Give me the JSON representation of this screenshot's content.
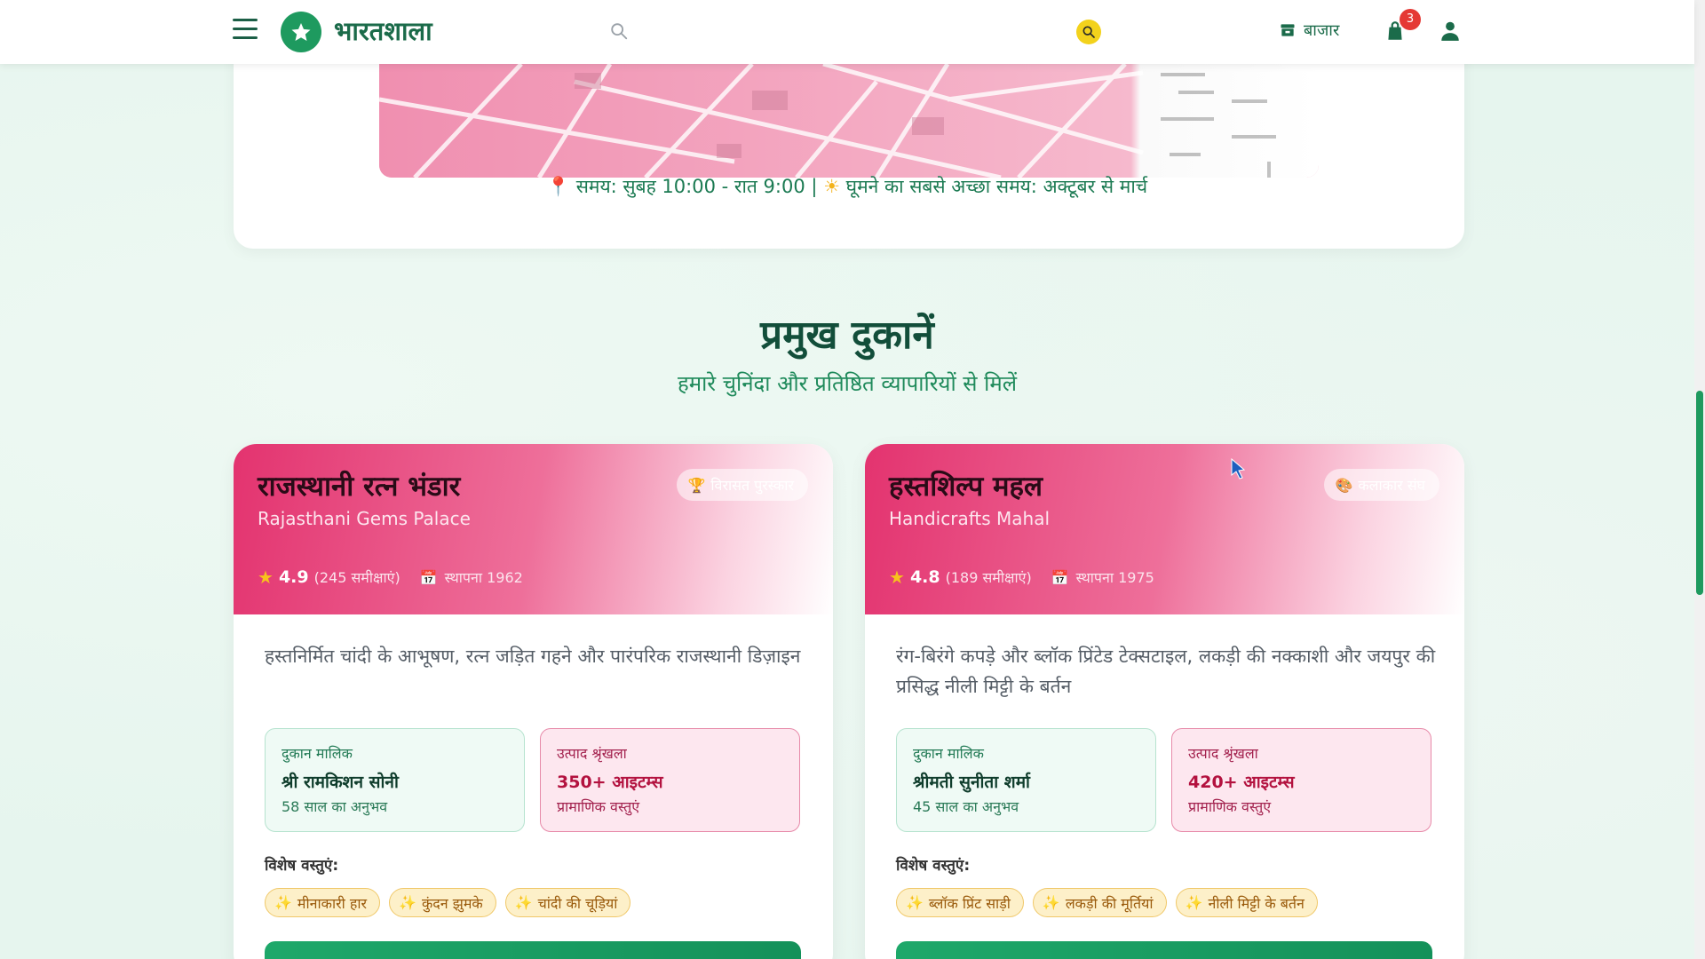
{
  "header": {
    "brand": "भारतशाला",
    "search_placeholder": "",
    "market_label": "बाजार",
    "cart_count": "3",
    "icons": {
      "menu": "hamburger-icon",
      "logo": "star-icon",
      "search": "search-icon",
      "search_button": "search-icon",
      "market": "store-icon",
      "cart": "shopping-bag-icon",
      "user": "user-icon"
    }
  },
  "market_info": {
    "timing": "समय: सुबह 10:00 - रात 9:00",
    "separator": "|",
    "best_time": "घूमने का सबसे अच्छा समय: अक्टूबर से मार्च"
  },
  "section": {
    "title": "प्रमुख दुकानें",
    "subtitle": "हमारे चुनिंदा और प्रतिष्ठित व्यापारियों से मिलें"
  },
  "shops": [
    {
      "name": "राजस्थानी रत्न भंडार",
      "name_en": "Rajasthani Gems Palace",
      "tag": "विरासत पुरस्कार",
      "rating": "4.9",
      "reviews": "(245 समीक्षाएं)",
      "established": "स्थापना 1962",
      "description": "हस्तनिर्मित चांदी के आभूषण, रत्न जड़ित गहने और पारंपरिक राजस्थानी डिज़ाइन",
      "owner_label": "दुकान मालिक",
      "owner_name": "श्री रामकिशन सोनी",
      "owner_exp": "58 साल का अनुभव",
      "range_label": "उत्पाद श्रृंखला",
      "range_value": "350+ आइटम्स",
      "range_sub": "प्रामाणिक वस्तुएं",
      "special_label": "विशेष वस्तुएं:",
      "specials": [
        "मीनाकारी हार",
        "कुंदन झुमके",
        "चांदी की चूड़ियां"
      ]
    },
    {
      "name": "हस्तशिल्प महल",
      "name_en": "Handicrafts Mahal",
      "tag": "कलाकार संघ",
      "rating": "4.8",
      "reviews": "(189 समीक्षाएं)",
      "established": "स्थापना 1975",
      "description": "रंग-बिरंगे कपड़े और ब्लॉक प्रिंटेड टेक्सटाइल, लकड़ी की नक्काशी और जयपुर की प्रसिद्ध नीली मिट्टी के बर्तन",
      "owner_label": "दुकान मालिक",
      "owner_name": "श्रीमती सुनीता शर्मा",
      "owner_exp": "45 साल का अनुभव",
      "range_label": "उत्पाद श्रृंखला",
      "range_value": "420+ आइटम्स",
      "range_sub": "प्रामाणिक वस्तुएं",
      "special_label": "विशेष वस्तुएं:",
      "specials": [
        "ब्लॉक प्रिंट साड़ी",
        "लकड़ी की मूर्तियां",
        "नीली मिट्टी के बर्तन"
      ]
    }
  ],
  "colors": {
    "brand_green": "#1e9a5f",
    "accent_pink": "#e3336f",
    "badge_red": "#e53935",
    "search_yellow": "#f3d21c"
  }
}
